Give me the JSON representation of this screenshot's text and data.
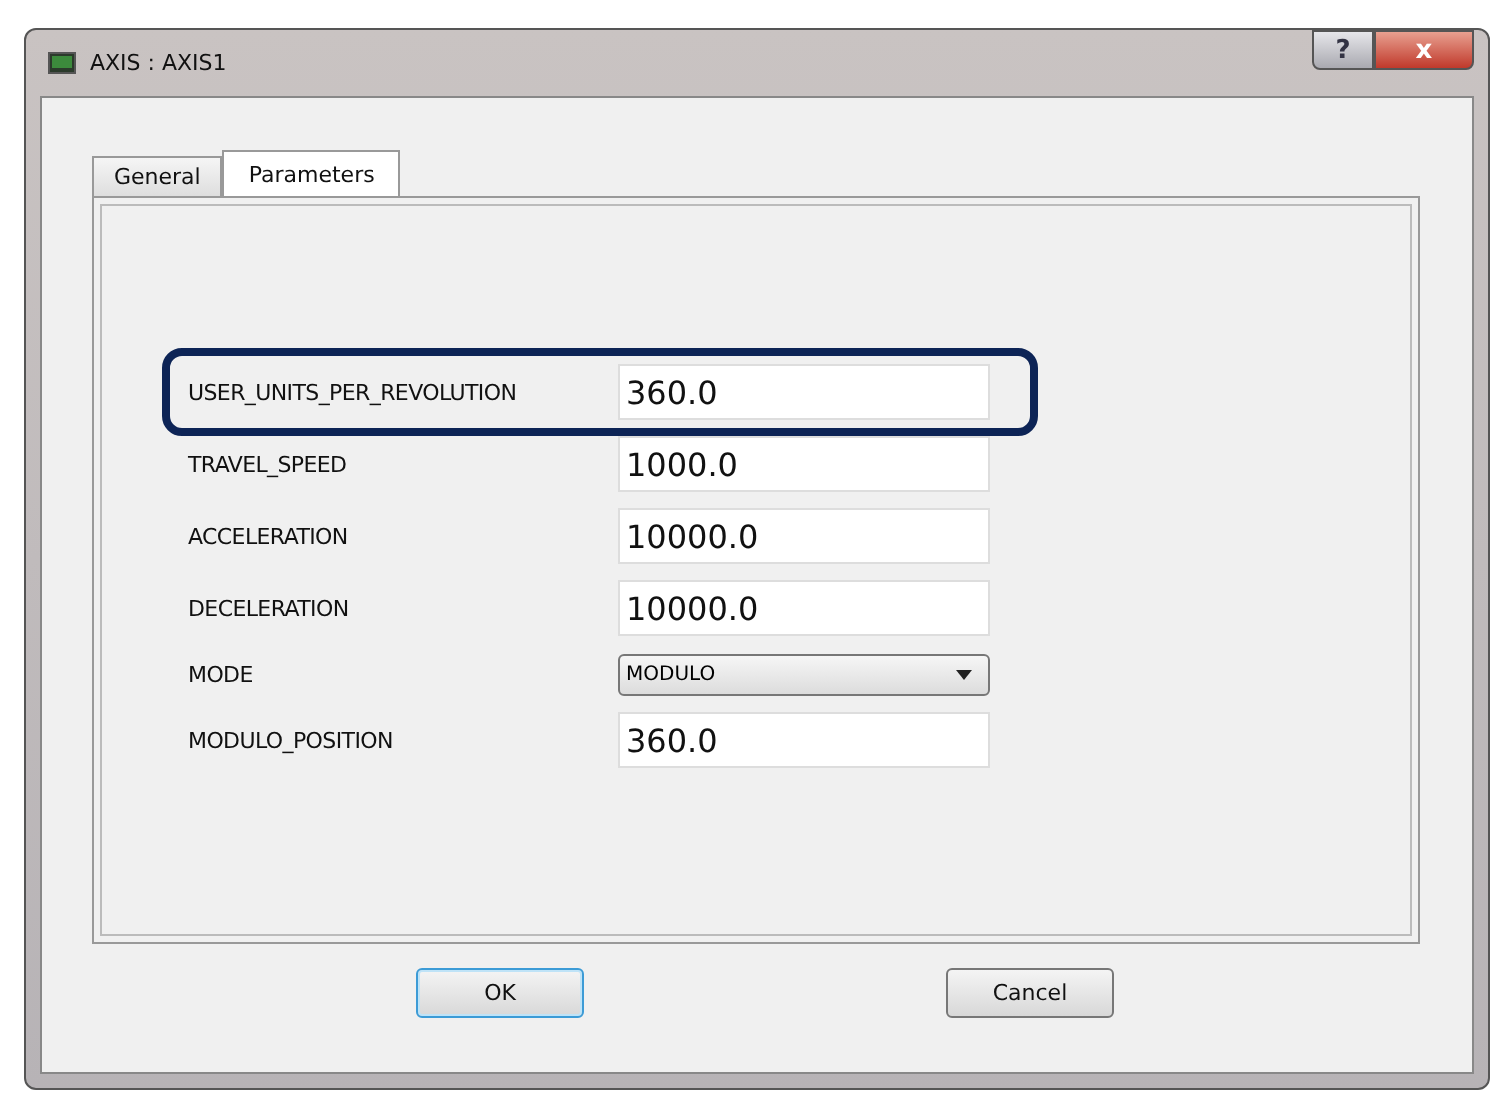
{
  "window": {
    "title": "AXIS : AXIS1",
    "help": "?",
    "close": "x"
  },
  "tabs": [
    {
      "label": "General",
      "selected": false
    },
    {
      "label": "Parameters",
      "selected": true
    }
  ],
  "parameters": [
    {
      "label": "USER_UNITS_PER_REVOLUTION",
      "kind": "text",
      "value": "360.0",
      "highlighted": true
    },
    {
      "label": "TRAVEL_SPEED",
      "kind": "text",
      "value": "1000.0",
      "highlighted": false
    },
    {
      "label": "ACCELERATION",
      "kind": "text",
      "value": "10000.0",
      "highlighted": false
    },
    {
      "label": "DECELERATION",
      "kind": "text",
      "value": "10000.0",
      "highlighted": false
    },
    {
      "label": "MODE",
      "kind": "select",
      "value": "MODULO",
      "highlighted": false
    },
    {
      "label": "MODULO_POSITION",
      "kind": "text",
      "value": "360.0",
      "highlighted": false
    }
  ],
  "buttons": [
    {
      "label": "OK",
      "default": true
    },
    {
      "label": "Cancel",
      "default": false
    }
  ]
}
